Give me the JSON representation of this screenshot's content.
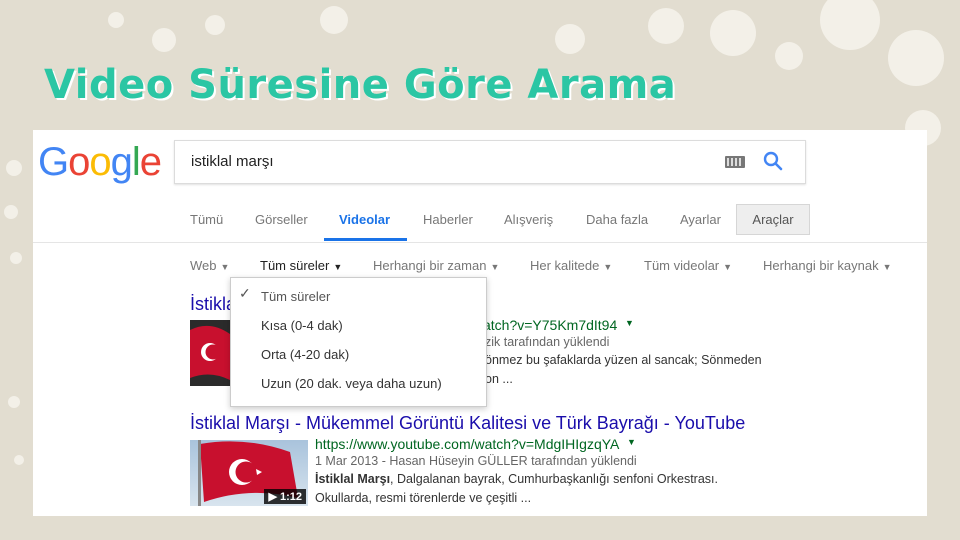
{
  "slide": {
    "title": "Video Süresine Göre Arama"
  },
  "google": {
    "logo_letters": [
      {
        "char": "G",
        "color": "#4285f4"
      },
      {
        "char": "o",
        "color": "#ea4335"
      },
      {
        "char": "o",
        "color": "#fbbc05"
      },
      {
        "char": "g",
        "color": "#4285f4"
      },
      {
        "char": "l",
        "color": "#34a853"
      },
      {
        "char": "e",
        "color": "#ea4335"
      }
    ],
    "search": {
      "query": "istiklal marşı",
      "icons": [
        "keyboard-icon",
        "search-icon"
      ]
    },
    "tabs": [
      "Tümü",
      "Görseller",
      "Videolar",
      "Haberler",
      "Alışveriş",
      "Daha fazla",
      "Ayarlar"
    ],
    "active_tab": "Videolar",
    "tools_label": "Araçlar",
    "filters": [
      "Web",
      "Tüm süreler",
      "Herhangi bir zaman",
      "Her kalitede",
      "Tüm videolar",
      "Herhangi bir kaynak"
    ],
    "selected_filter": "Tüm süreler",
    "duration_menu": {
      "items": [
        "Tüm süreler",
        "Kısa (0-4 dak)",
        "Orta (4-20 dak)",
        "Uzun (20 dak. veya daha uzun)"
      ],
      "checked": "Tüm süreler"
    },
    "results": [
      {
        "title_visible": "İstikla",
        "url_visible": "atch?v=Y75Km7dIt94",
        "meta_visible": "zik tarafından yüklendi",
        "snippet_line1": "önmez bu şafaklarda yüzen al sancak; Sönmeden",
        "snippet_line2": "on ..."
      },
      {
        "title": "İstiklal Marşı - Mükemmel Görüntü Kalitesi ve Türk Bayrağı - YouTube",
        "url": "https://www.youtube.com/watch?v=MdgIHIgzqYA",
        "meta": "1 Mar 2013 - Hasan Hüseyin GÜLLER tarafından yüklendi",
        "snippet_bold": "İstiklal Marşı",
        "snippet_line1_rest": ", Dalgalanan bayrak, Cumhurbaşkanlığı senfoni Orkestrası.",
        "snippet_line2": "Okullarda, resmi törenlerde ve çeşitli ...",
        "duration": "▶ 1:12"
      }
    ],
    "colors": {
      "link": "#1a0dab",
      "url": "#006621",
      "accent": "#1a73e8",
      "title": "#2bc6a4"
    }
  }
}
